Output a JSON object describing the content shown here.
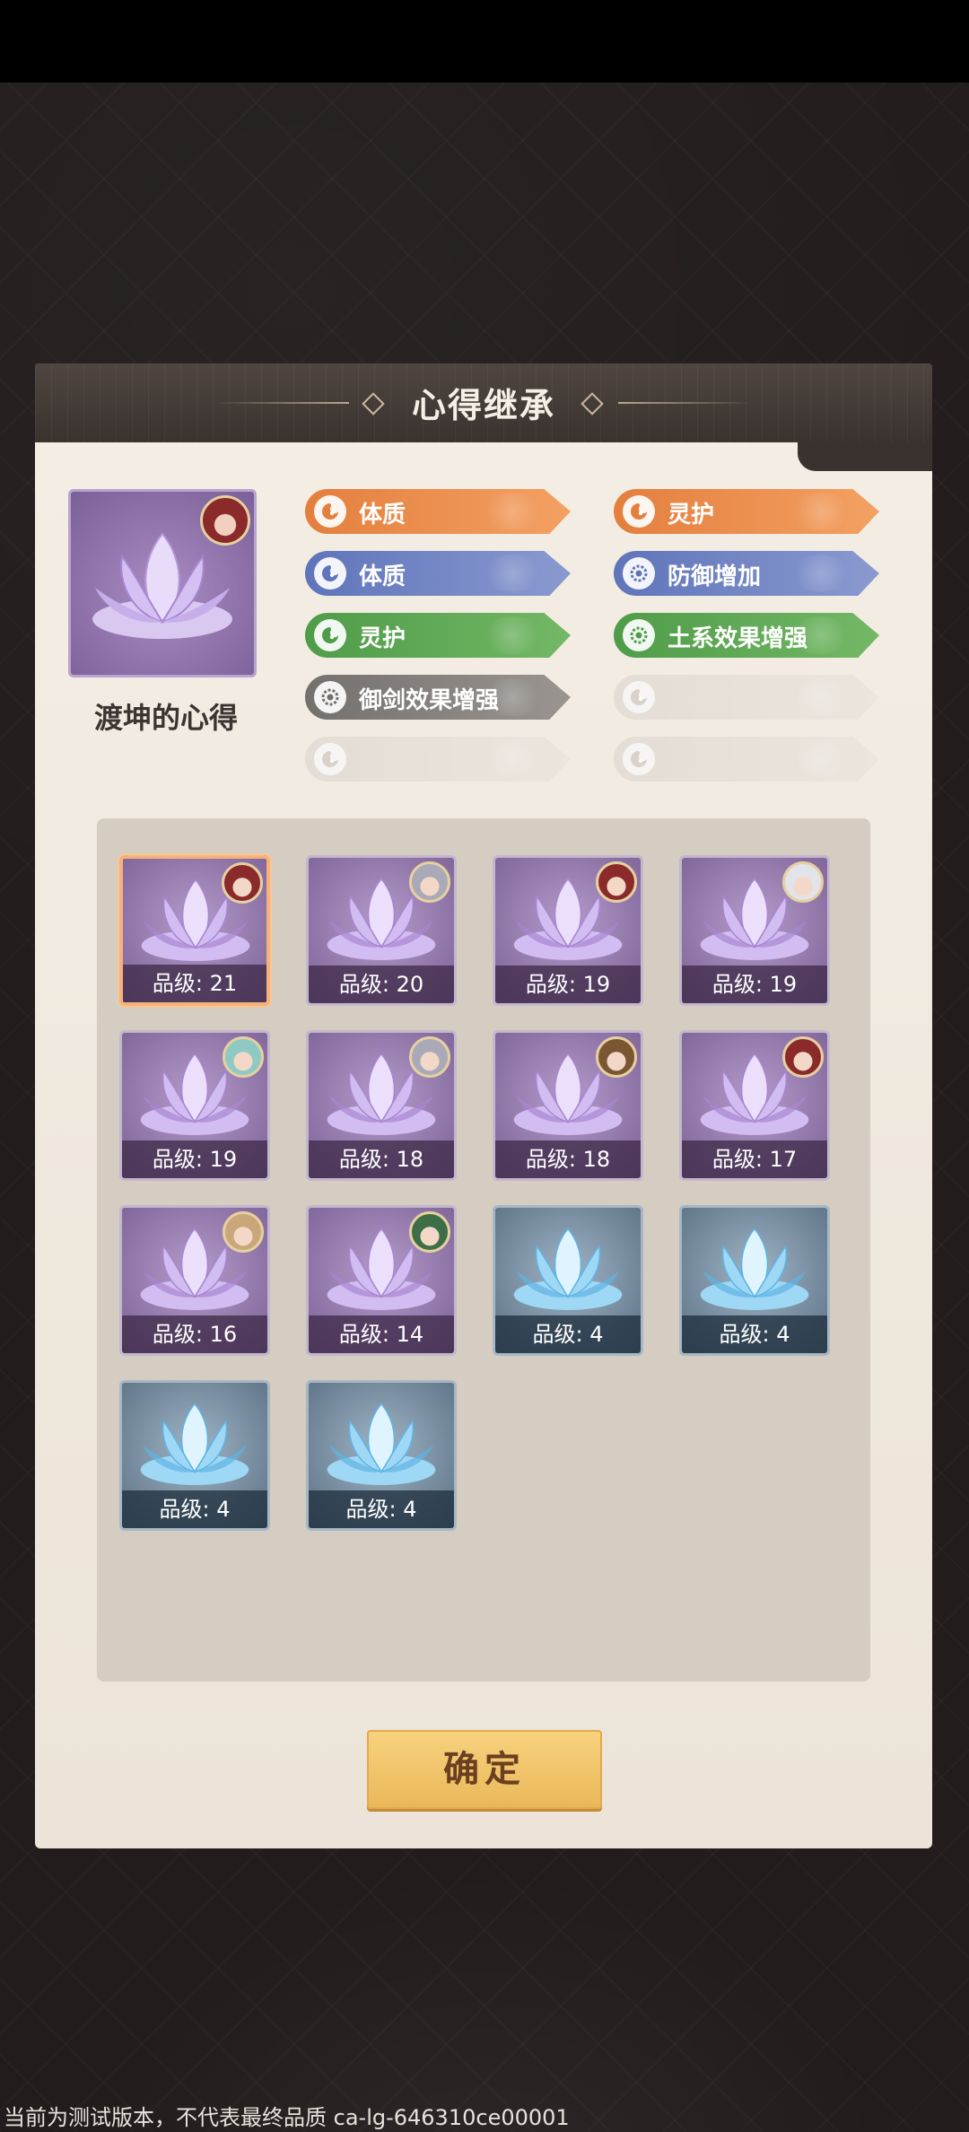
{
  "dialog": {
    "title": "心得继承",
    "confirm_label": "确定"
  },
  "selected": {
    "name": "渡坤的心得",
    "icon": "purple-lotus-icon"
  },
  "tags": [
    {
      "label": "体质",
      "color": "orange",
      "icon": "swirl-icon"
    },
    {
      "label": "灵护",
      "color": "orange",
      "icon": "swirl-icon"
    },
    {
      "label": "体质",
      "color": "blue",
      "icon": "swirl-icon"
    },
    {
      "label": "防御增加",
      "color": "blue",
      "icon": "gear-icon"
    },
    {
      "label": "灵护",
      "color": "green",
      "icon": "swirl-icon"
    },
    {
      "label": "土系效果增强",
      "color": "green",
      "icon": "gear-icon"
    },
    {
      "label": "御剑效果增强",
      "color": "gray",
      "icon": "gear-icon"
    },
    {
      "label": "",
      "color": "empty",
      "icon": "swirl-icon"
    },
    {
      "label": "",
      "color": "empty",
      "icon": "swirl-icon"
    },
    {
      "label": "",
      "color": "empty",
      "icon": "swirl-icon"
    }
  ],
  "hearts": [
    {
      "grade": "品级: 21",
      "lotus": "purple",
      "avatar": "red-hair-avatar",
      "selected": true
    },
    {
      "grade": "品级: 20",
      "lotus": "purple",
      "avatar": "silver-hair-avatar"
    },
    {
      "grade": "品级: 19",
      "lotus": "purple",
      "avatar": "red-hair-avatar"
    },
    {
      "grade": "品级: 19",
      "lotus": "purple",
      "avatar": "white-hair-avatar"
    },
    {
      "grade": "品级: 19",
      "lotus": "purple",
      "avatar": "teal-hair-avatar"
    },
    {
      "grade": "品级: 18",
      "lotus": "purple",
      "avatar": "silver-hair-avatar"
    },
    {
      "grade": "品级: 18",
      "lotus": "purple",
      "avatar": "brown-hair-avatar"
    },
    {
      "grade": "品级: 17",
      "lotus": "purple",
      "avatar": "red-hair-avatar"
    },
    {
      "grade": "品级: 16",
      "lotus": "purple",
      "avatar": "blonde-hair-avatar"
    },
    {
      "grade": "品级: 14",
      "lotus": "purple",
      "avatar": "green-hair-avatar"
    },
    {
      "grade": "品级: 4",
      "lotus": "cyan"
    },
    {
      "grade": "品级: 4",
      "lotus": "cyan"
    },
    {
      "grade": "品级: 4",
      "lotus": "cyan"
    },
    {
      "grade": "品级: 4",
      "lotus": "cyan"
    }
  ],
  "colors": {
    "orange": "#e47f3d",
    "blue": "#5f74ba",
    "green": "#4f9c48",
    "gray": "#74706d",
    "accent_gold": "#eab85a"
  },
  "watermark": "当前为测试版本，不代表最终品质  ca-lg-646310ce00001"
}
